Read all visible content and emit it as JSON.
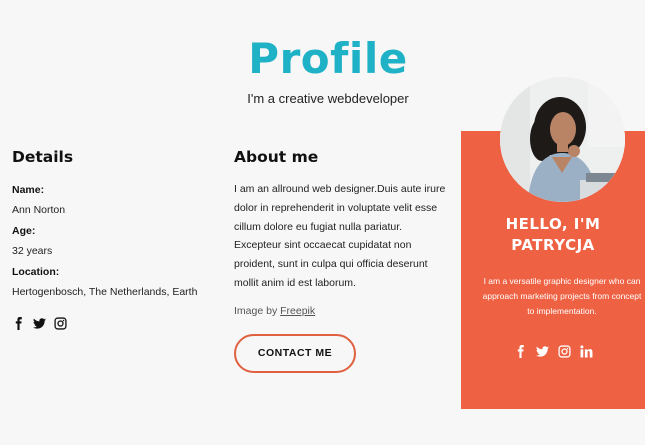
{
  "header": {
    "title": "Profile",
    "subtitle": "I'm a creative webdeveloper"
  },
  "details": {
    "heading": "Details",
    "name_label": "Name:",
    "name_value": "Ann Norton",
    "age_label": "Age:",
    "age_value": "32 years",
    "location_label": "Location:",
    "location_value": "Hertogenbosch, The Netherlands, Earth",
    "social_icons": [
      "facebook-icon",
      "twitter-icon",
      "instagram-icon"
    ]
  },
  "about": {
    "heading": "About me",
    "text": "I am an allround web designer.Duis aute irure dolor in reprehenderit in voluptate velit esse cillum dolore eu fugiat nulla pariatur. Excepteur sint occaecat cupidatat non proident, sunt in culpa qui officia deserunt mollit anim id est laborum.",
    "credit_prefix": "Image by",
    "credit_link": "Freepik",
    "contact_label": "CONTACT ME"
  },
  "card": {
    "title": "HELLO, I'M PATRYCJA",
    "text": "I am a versatile graphic designer who can approach marketing projects from concept to implementation.",
    "social_icons": [
      "facebook-icon",
      "twitter-icon",
      "instagram-icon",
      "linkedin-icon"
    ]
  },
  "colors": {
    "accent_teal": "#1fb2c6",
    "card_bg": "#ee6143",
    "page_bg": "#f7f7f7"
  }
}
